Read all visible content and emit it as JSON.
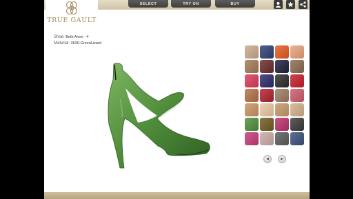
{
  "brand": {
    "name": "TRUE GAULT",
    "logo_icon": "interlocked-rings-logo"
  },
  "nav": {
    "select_label": "SELECT",
    "tryon_label": "TRY ON",
    "buy_label": "BUY"
  },
  "toolbar_icons": [
    "user-icon",
    "star-icon",
    "share-icon"
  ],
  "product": {
    "shoe_key": "Shoe:",
    "shoe_value": "Beth Anne - 4",
    "material_key": "Material:",
    "material_value": "3630-GreenLizard"
  },
  "colors": {
    "shoe_main": "#4f8c3a",
    "shoe_dark": "#2f5e24",
    "shoe_light": "#7fb662",
    "gold": "#a68b5a"
  },
  "swatches": [
    "#c9a98a",
    "#2e3e73",
    "#e35a1f",
    "#e8a07a",
    "#a07a55",
    "#6a2a2a",
    "#1e1e3a",
    "#8a6a50",
    "#d63a5a",
    "#2a2a6a",
    "#2b2b2b",
    "#c41e2a",
    "#b07048",
    "#b02030",
    "#9a7a62",
    "#cc5a6a",
    "#c7935f",
    "#e8c4a2",
    "#c2986a",
    "#cfb08a",
    "#4f8c3a",
    "#6e5a1e",
    "#b8306a",
    "#3a3a3a",
    "#c43a7a",
    "#c9a9a2",
    "#5a5a5a",
    "#3a4f7a"
  ],
  "carousel": {
    "prev_icon": "chevron-left-icon",
    "next_icon": "chevron-right-icon"
  }
}
